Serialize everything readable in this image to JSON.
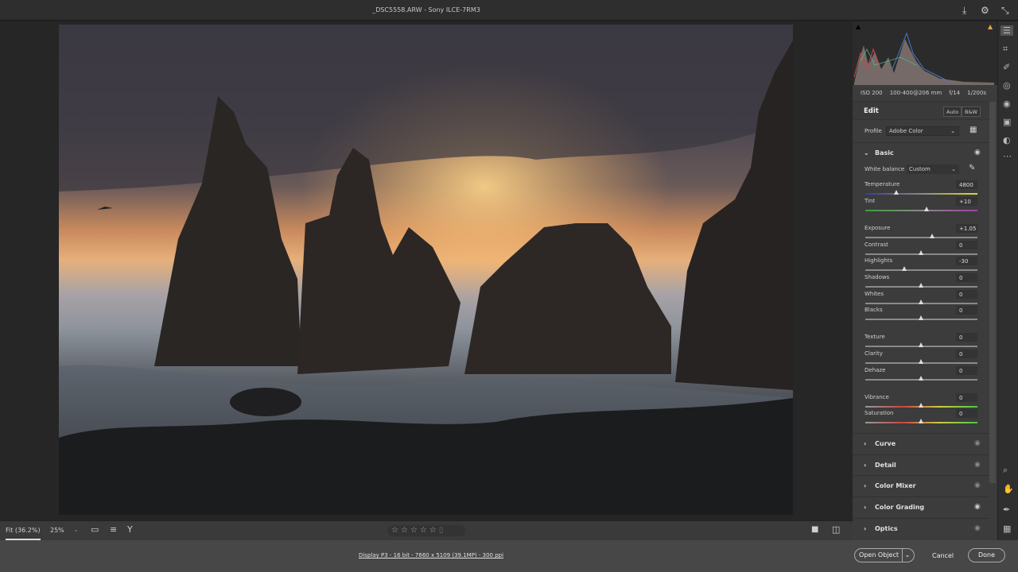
{
  "title": "_DSC5558.ARW  -  Sony ILCE-7RM3",
  "exif": {
    "iso": "ISO 200",
    "lens": "100-400@206 mm",
    "aperture": "f/14",
    "shutter": "1/200s"
  },
  "edit": {
    "title": "Edit",
    "auto": "Auto",
    "bw": "B&W"
  },
  "profile": {
    "label": "Profile",
    "value": "Adobe Color"
  },
  "basic": {
    "title": "Basic",
    "white_balance_label": "White balance",
    "white_balance": "Custom",
    "sliders": [
      {
        "label": "Temperature",
        "value": "4800",
        "level": 0.28,
        "kind": "temp"
      },
      {
        "label": "Tint",
        "value": "+10",
        "level": 0.55,
        "kind": "tint"
      },
      {
        "label": "Exposure",
        "value": "+1.05",
        "level": 0.6
      },
      {
        "label": "Contrast",
        "value": "0",
        "level": 0.5
      },
      {
        "label": "Highlights",
        "value": "-30",
        "level": 0.35
      },
      {
        "label": "Shadows",
        "value": "0",
        "level": 0.5
      },
      {
        "label": "Whites",
        "value": "0",
        "level": 0.5
      },
      {
        "label": "Blacks",
        "value": "0",
        "level": 0.5
      },
      {
        "label": "Texture",
        "value": "0",
        "level": 0.5
      },
      {
        "label": "Clarity",
        "value": "0",
        "level": 0.5
      },
      {
        "label": "Dehaze",
        "value": "0",
        "level": 0.5
      },
      {
        "label": "Vibrance",
        "value": "0",
        "level": 0.5,
        "kind": "sat"
      },
      {
        "label": "Saturation",
        "value": "0",
        "level": 0.5,
        "kind": "sat"
      }
    ]
  },
  "sections": [
    "Curve",
    "Detail",
    "Color Mixer",
    "Color Grading",
    "Optics"
  ],
  "bottom": {
    "fit": "Fit (36.2%)",
    "zoom": "25%",
    "stars": "☆☆☆☆☆"
  },
  "status": {
    "info": "Display P3 - 16 bit - 7660 x 5109 (39.1MP) - 300 ppi",
    "open": "Open Object",
    "cancel": "Cancel",
    "done": "Done"
  }
}
